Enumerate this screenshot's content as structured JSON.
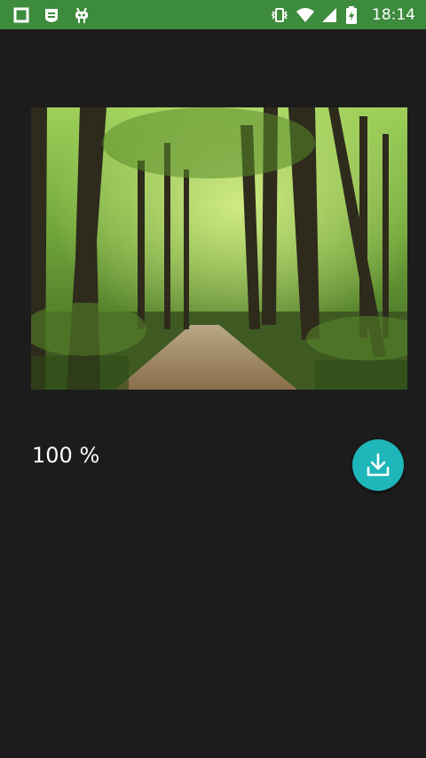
{
  "status_bar": {
    "time": "18:14",
    "left_icons": [
      "square-notification-icon",
      "chat-notification-icon",
      "android-debug-icon"
    ],
    "right_icons": [
      "vibrate-icon",
      "wifi-icon",
      "signal-icon",
      "battery-charging-icon"
    ],
    "background": "#3d8b3d"
  },
  "download": {
    "progress_text": "100 %",
    "progress_value": 1.0,
    "image": "forest-path-photo",
    "button_icon": "download-icon",
    "button_color": "#1fb6b9"
  }
}
